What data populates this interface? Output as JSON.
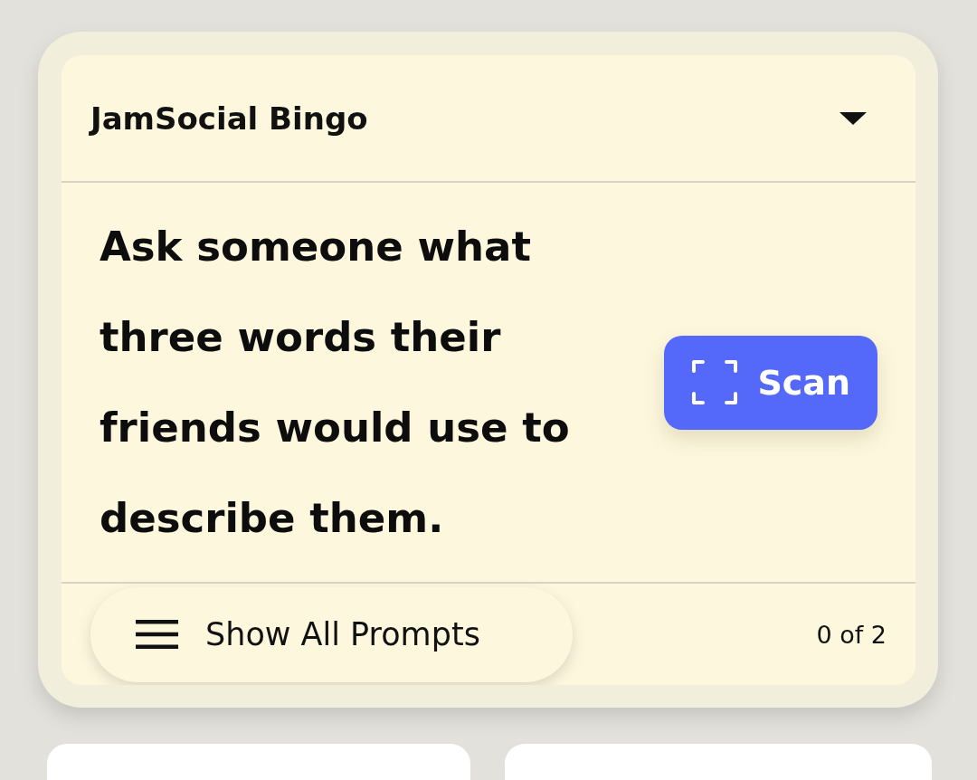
{
  "header": {
    "title": "JamSocial Bingo",
    "expanded": false
  },
  "prompt": {
    "text": "Ask someone what three words their friends would use to describe them."
  },
  "scan_button": {
    "label": "Scan"
  },
  "footer": {
    "show_all_button": {
      "label": "Show All Prompts"
    },
    "progress": "0 of 2"
  }
}
